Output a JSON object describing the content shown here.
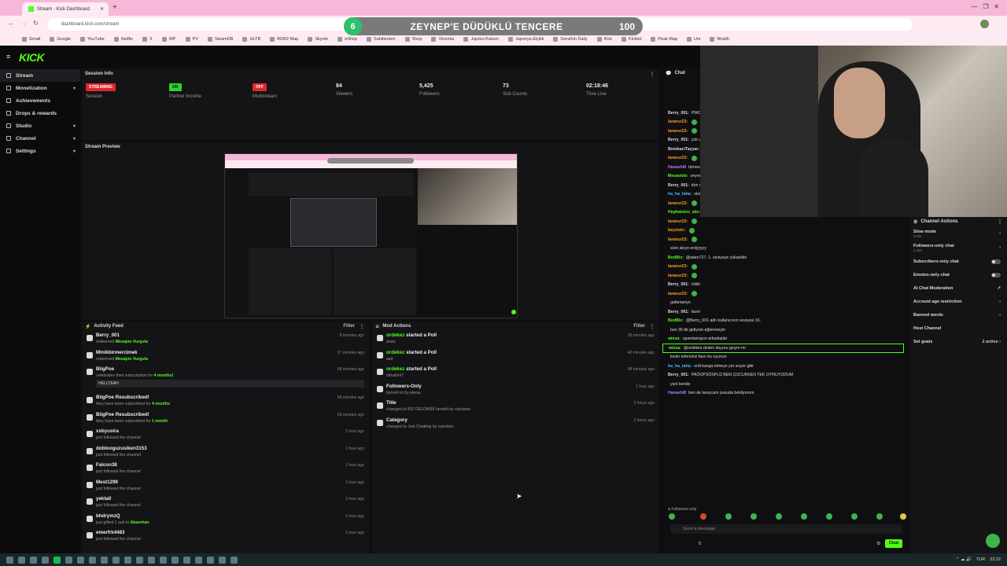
{
  "browser": {
    "tab_title": "Stream - Kick Dashboard",
    "url": "dashboard.kick.com/stream",
    "bookmarks": [
      "Gmail",
      "Google",
      "YouTube",
      "Netflix",
      "X",
      "WP",
      "PV",
      "SteamDB",
      "HLTB",
      "RDR2 Map",
      "Skyrim",
      "eShop",
      "Sahibinden",
      "Shop",
      "Vinemia",
      "Jujutsu Kaisen",
      "Japonya Elçilik",
      "Genshin Daily",
      "Kick",
      "Kicklet",
      "Peak Map",
      "Uni",
      "Wraith"
    ]
  },
  "overlay": {
    "count": "6",
    "title": "ZEYNEP'E DÜDÜKLÜ TENCERE",
    "goal": "100"
  },
  "app": {
    "logo": "KICK"
  },
  "sidebar": {
    "items": [
      {
        "label": "Stream",
        "chev": ""
      },
      {
        "label": "Monetization",
        "chev": "▾"
      },
      {
        "label": "Achievements",
        "chev": ""
      },
      {
        "label": "Drops & rewards",
        "chev": ""
      },
      {
        "label": "Studio",
        "chev": "▾"
      },
      {
        "label": "Channel",
        "chev": "▾"
      },
      {
        "label": "Settings",
        "chev": "▾"
      }
    ]
  },
  "session": {
    "title": "Session Info",
    "stats": [
      {
        "badge": "STREAMING",
        "badge_color": "red",
        "value": "",
        "label": "Session"
      },
      {
        "badge": "ON",
        "badge_color": "green",
        "value": "",
        "label": "Partner Income"
      },
      {
        "badge": "OFF",
        "badge_color": "red",
        "value": "",
        "label": "Multistream"
      },
      {
        "badge": "",
        "badge_color": "",
        "value": "84",
        "label": "Viewers"
      },
      {
        "badge": "",
        "badge_color": "",
        "value": "5,425",
        "label": "Followers"
      },
      {
        "badge": "",
        "badge_color": "",
        "value": "73",
        "label": "Sub Counts"
      },
      {
        "badge": "",
        "badge_color": "",
        "value": "02:18:46",
        "label": "Time Live"
      }
    ]
  },
  "preview": {
    "title": "Stream Preview"
  },
  "activity": {
    "title": "Activity Feed",
    "filter": "Filter",
    "rows": [
      {
        "name": "Berry_001",
        "sub": "redeemed",
        "hl": "Mesajını Vurgula",
        "time": "8 minutes ago",
        "quote": ""
      },
      {
        "name": "Minikbirmercimek",
        "sub": "redeemed",
        "hl": "Mesajını Vurgula",
        "time": "37 minutes ago",
        "quote": ""
      },
      {
        "name": "BiigPoe",
        "sub": "celebrates their subscription for",
        "hl": "4 months!",
        "time": "58 minutes ago",
        "quote": "HELLYEAH"
      },
      {
        "name": "BiigPoe Resubscribed!",
        "sub": "they have been subscribed for",
        "hl": "4 months",
        "time": "58 minutes ago",
        "quote": ""
      },
      {
        "name": "BiigPoe Resubscribed!",
        "sub": "they have been subscribed for",
        "hl": "1 month",
        "time": "59 minutes ago",
        "quote": ""
      },
      {
        "name": "xxbyusira",
        "sub": "just followed the channel",
        "hl": "",
        "time": "1 hour ago",
        "quote": ""
      },
      {
        "name": "doblooguzusiken3153",
        "sub": "just followed the channel",
        "hl": "",
        "time": "1 hour ago",
        "quote": ""
      },
      {
        "name": "Falcon38",
        "sub": "just followed the channel",
        "hl": "",
        "time": "1 hour ago",
        "quote": ""
      },
      {
        "name": "Mest1299",
        "sub": "just followed the channel",
        "hl": "",
        "time": "1 hour ago",
        "quote": ""
      },
      {
        "name": "yektall",
        "sub": "just followed the channel",
        "hl": "",
        "time": "1 hour ago",
        "quote": ""
      },
      {
        "name": "bhdrymzQ",
        "sub": "just gifted 1 sub to",
        "hl": "Akaorhan",
        "time": "1 hour ago",
        "quote": ""
      },
      {
        "name": "emerfrk4483",
        "sub": "just followed the channel",
        "hl": "",
        "time": "1 hour ago",
        "quote": ""
      }
    ]
  },
  "mod": {
    "title": "Mod Actions",
    "filter": "Filter",
    "rows": [
      {
        "actor": "ordekez",
        "action": "started a Poll",
        "sub": "anan",
        "time": "39 minutes ago"
      },
      {
        "actor": "ordekez",
        "action": "started a Poll",
        "sub": "asd",
        "time": "40 minutes ago"
      },
      {
        "actor": "ordekez",
        "action": "started a Poll",
        "sub": "olmalimi?",
        "time": "48 minutes ago"
      },
      {
        "actor": "",
        "action": "Followers-Only",
        "sub": "turned on by wiesa",
        "time": "1 hour ago"
      },
      {
        "actor": "",
        "action": "Title",
        "sub": "changed to BİZ GELDİKİİİİ herakh by cahoben",
        "time": "2 hours ago"
      },
      {
        "actor": "",
        "action": "Category",
        "sub": "changed to Just Chatting by cahoben",
        "time": "2 hours ago"
      }
    ]
  },
  "chat": {
    "title": "Chat",
    "lines": [
      {
        "user": "Berry_001:",
        "color": "#ddd",
        "text": "PWO... ONADA"
      },
      {
        "user": "laranur23:",
        "color": "#ff9f1a",
        "text": ""
      },
      {
        "user": "laranur23:",
        "color": "#ff9f1a",
        "text": ""
      },
      {
        "user": "Berry_001:",
        "color": "#ddd",
        "text": "çok u"
      },
      {
        "user": "BombaciTayyar:",
        "color": "#ddd",
        "text": ""
      },
      {
        "user": "laranur23:",
        "color": "#ff9f1a",
        "text": ""
      },
      {
        "user": "Hanashi8",
        "color": "#b07cff",
        "text": "tümevarsamak gibi oldu"
      },
      {
        "user": "Mesaoido:",
        "color": "#53fc18",
        "text": "zeynep guccuk biişi uzun gelmez"
      },
      {
        "user": "Berry_001:",
        "color": "#ddd",
        "text": "tüm olayı çözmüş"
      },
      {
        "user": "ha_ha_taha:",
        "color": "#4db3ff",
        "text": "story için geç kalmadınız mi"
      },
      {
        "user": "laranur23:",
        "color": "#ff9f1a",
        "text": ""
      },
      {
        "user": "Hephaistos_abc:",
        "color": "#53fc18",
        "text": "2 SAATTİR YAYINDASINIZ VE İKİNCİ SANDALYE ŞİMDİ Mİ AKLINIZA GELDİ DSHSDGNBDSNG"
      },
      {
        "user": "laranur23:",
        "color": "#ff9f1a",
        "text": ""
      },
      {
        "user": "beyzisin:",
        "color": "#ff9f1a",
        "text": ""
      },
      {
        "user": "laranur23:",
        "color": "#ff9f1a",
        "text": ""
      },
      {
        "user": "",
        "color": "#ff4d4d",
        "text": "süre akıyo erdyyyyy"
      },
      {
        "user": "BodBix:",
        "color": "#53fc18",
        "text": "@aden727, 1. seviyeye yükseldin"
      },
      {
        "user": "laranur23:",
        "color": "#ff9f1a",
        "text": ""
      },
      {
        "user": "laranur23:",
        "color": "#ff9f1a",
        "text": ""
      },
      {
        "user": "Berry_001:",
        "color": "#ddd",
        "text": "Hiiiiö"
      },
      {
        "user": "laranur23:",
        "color": "#ff9f1a",
        "text": ""
      },
      {
        "user": "",
        "color": "#ff4d4d",
        "text": "gafamanyo"
      },
      {
        "user": "Berry_001:",
        "color": "#ddd",
        "text": "favel"
      },
      {
        "user": "BodBix:",
        "color": "#53fc18",
        "text": "@Berry_001 adlı kullanıcının seviyesi 16."
      },
      {
        "user": "",
        "color": "#ff4d4d",
        "text": "ben 30 dk gidiyom eğlenmeyin"
      },
      {
        "user": "wiesa:",
        "color": "#53fc18",
        "text": "spamlamayın arkadaşlar"
      },
      {
        "user": "wiesa:",
        "color": "#53fc18",
        "text": "@ordekez dcden duyuru geçim mi"
      },
      {
        "user": "",
        "color": "#ff4d4d",
        "text": "kesin edersiniz farzı bu oyunun"
      },
      {
        "user": "ha_ha_taha:",
        "color": "#4db3ff",
        "text": "erdi kavga etmeye yer arıyor gibi"
      },
      {
        "user": "Berry_001:",
        "color": "#ddd",
        "text": "PAÖOPSÖSPLD BEN ÇOCUKKEN TEK OYNUYODUM"
      },
      {
        "user": "",
        "color": "#ff4d4d",
        "text": "yani bende"
      },
      {
        "user": "Hanashi8",
        "color": "#b07cff",
        "text": "ben de tanıycam pusuda bekliyorum"
      }
    ],
    "followers_only": "Followers only",
    "send_placeholder": "Send a message",
    "chat_button": "Chat",
    "viewers": "0"
  },
  "channel_actions": {
    "title": "Channel Actions",
    "items": [
      {
        "label": "Slow mode",
        "sub": "3 sec",
        "right": "›"
      },
      {
        "label": "Followers-only chat",
        "sub": "1 min",
        "right": "›"
      },
      {
        "label": "Subscribers-only chat",
        "sub": "",
        "right": "toggle"
      },
      {
        "label": "Emotes-only chat",
        "sub": "",
        "right": "toggle"
      },
      {
        "label": "AI Chat Moderation",
        "sub": "",
        "right": "↗"
      },
      {
        "label": "Account age restriction",
        "sub": "",
        "right": "›"
      },
      {
        "label": "Banned words",
        "sub": "",
        "right": "›"
      },
      {
        "label": "Host Channel",
        "sub": "",
        "right": ""
      },
      {
        "label": "Set goals",
        "sub": "",
        "right": "2 active ›"
      }
    ]
  },
  "taskbar": {
    "lang": "TUR",
    "time": "22:22"
  },
  "colors": {
    "accent": "#53fc18",
    "live_red": "#e0262d",
    "bg": "#0e0e10"
  }
}
